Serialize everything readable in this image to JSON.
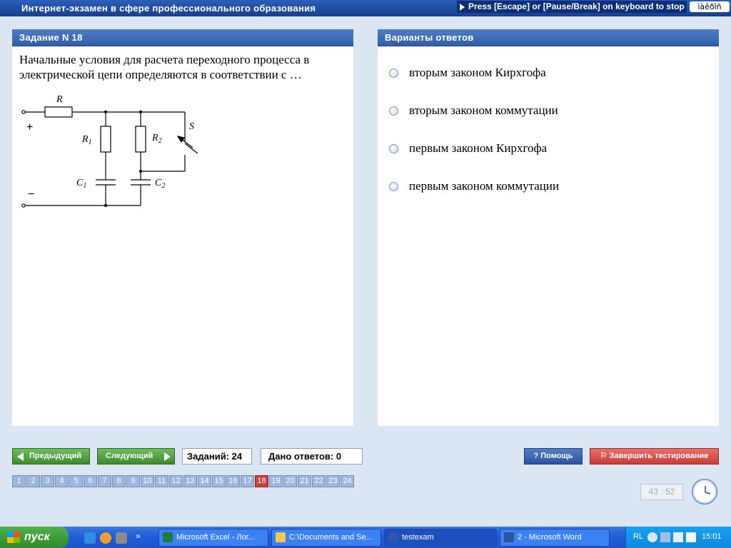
{
  "titlebar": {
    "title": "Интернет-экзамен в сфере профессионального образования",
    "escape_hint": "Press [Escape] or [Pause/Break] on keyboard to stop",
    "lang_indicator": "ìàêðîñ"
  },
  "task_panel": {
    "header": "Задание N 18",
    "question": "Начальные условия для расчета переходного процесса в электрической цепи определяются в соответствии с …",
    "circuit": {
      "R": "R",
      "R1": "R",
      "R1_sub": "1",
      "R2": "R",
      "R2_sub": "2",
      "C1": "C",
      "C1_sub": "1",
      "C2": "C",
      "C2_sub": "2",
      "S": "S",
      "plus": "+",
      "minus": "−"
    }
  },
  "answers_panel": {
    "header": "Варианты ответов",
    "options": [
      "вторым законом Кирхгофа",
      "вторым законом коммутации",
      "первым законом Кирхгофа",
      "первым законом коммутации"
    ]
  },
  "controls": {
    "prev_label": "Предыдущий",
    "next_label": "Следующий",
    "tasks_count": "Заданий: 24",
    "answers_given": "Дано ответов: 0",
    "help_label": "Помощь",
    "finish_label": "Завершить тестирование",
    "pages": [
      "1",
      "2",
      "3",
      "4",
      "5",
      "6",
      "7",
      "8",
      "9",
      "10",
      "11",
      "12",
      "13",
      "14",
      "15",
      "16",
      "17",
      "18",
      "19",
      "20",
      "21",
      "22",
      "23",
      "24"
    ],
    "current_page": "18",
    "timer": "43 : 52"
  },
  "taskbar": {
    "start_label": "пуск",
    "quicklaunch_more": "»",
    "tasks": [
      "Microsoft Excel - Лог...",
      "C:\\Documents and Se...",
      "testexam",
      "2 - Microsoft Word"
    ],
    "lang": "RL",
    "clock": "15:01"
  },
  "colors": {
    "title_bar": "#1f4ea3",
    "panel_header": "#3b69b5",
    "nav_button": "#4fa23e",
    "finish_button": "#d8504b",
    "active_page": "#c8423b"
  }
}
